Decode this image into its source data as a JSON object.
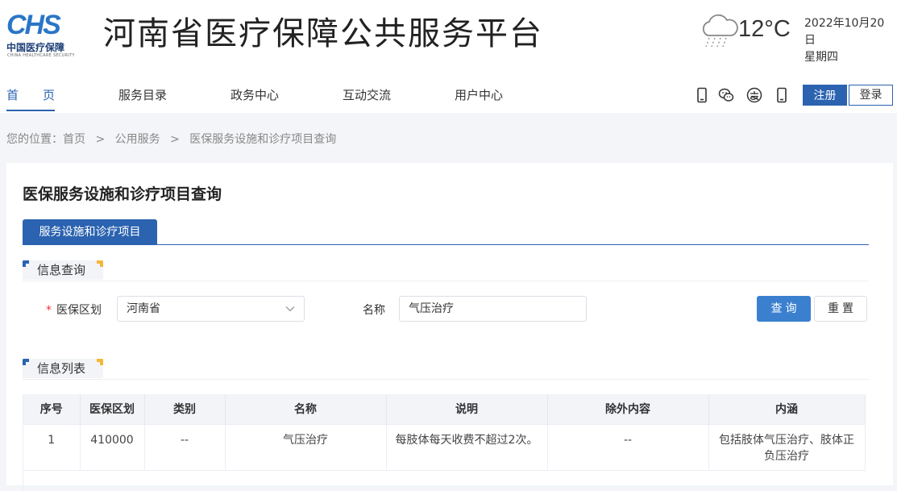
{
  "header": {
    "logo_mark": "CHS",
    "logo_cn": "中国医疗保障",
    "logo_en": "CHINA HEALTHCARE SECURITY",
    "site_title": "河南省医疗保障公共服务平台",
    "weather": {
      "icon": "rain-cloud-icon",
      "temperature": "12°C"
    },
    "date": {
      "line1": "2022年10月20日",
      "line2": "星期四"
    }
  },
  "nav": {
    "items": [
      {
        "label": "首　　页",
        "active": true
      },
      {
        "label": "服务目录",
        "active": false
      },
      {
        "label": "政务中心",
        "active": false
      },
      {
        "label": "互动交流",
        "active": false
      },
      {
        "label": "用户中心",
        "active": false
      }
    ],
    "tool_icons": [
      "mobile-icon",
      "wechat-icon",
      "alipay-icon",
      "phone-icon"
    ],
    "register_label": "注册",
    "login_label": "登录"
  },
  "breadcrumb": {
    "prefix": "您的位置：",
    "items": [
      "首页",
      "公用服务",
      "医保服务设施和诊疗项目查询"
    ],
    "separator": ">"
  },
  "main": {
    "title": "医保服务设施和诊疗项目查询",
    "tab_label": "服务设施和诊疗项目",
    "query_section": "信息查询",
    "list_section": "信息列表",
    "form": {
      "region_required_mark": "*",
      "region_label": "医保区划",
      "region_value": "河南省",
      "name_label": "名称",
      "name_value": "气压治疗",
      "query_label": "查询",
      "reset_label": "重置"
    },
    "table": {
      "headers": [
        "序号",
        "医保区划",
        "类别",
        "名称",
        "说明",
        "除外内容",
        "内涵"
      ],
      "rows": [
        [
          "1",
          "410000",
          "--",
          "气压治疗",
          "每肢体每天收费不超过2次。",
          "--",
          "包括肢体气压治疗、肢体正负压治疗"
        ]
      ]
    }
  },
  "colors": {
    "accent": "#2b63b0",
    "button": "#3b80cf",
    "required": "#e33333",
    "corner": "#f4b63a"
  }
}
